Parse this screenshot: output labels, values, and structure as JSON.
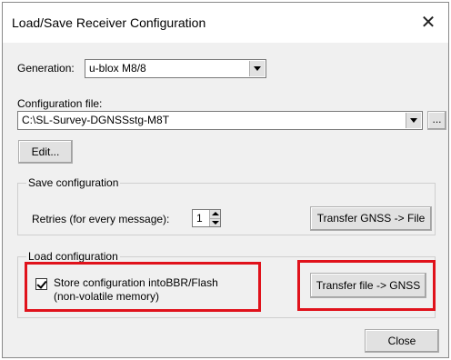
{
  "window": {
    "title": "Load/Save Receiver Configuration",
    "close_glyph": "✕"
  },
  "generation": {
    "label": "Generation:",
    "value": "u-blox M8/8"
  },
  "config_file": {
    "label": "Configuration file:",
    "value": "C:\\SL-Survey-DGNSSstg-M8T",
    "browse_label": "...",
    "edit_label": "Edit..."
  },
  "save": {
    "group_label": "Save configuration",
    "retries_label": "Retries (for every message):",
    "retries_value": "1",
    "transfer_label": "Transfer GNSS -> File"
  },
  "load": {
    "group_label": "Load configuration",
    "store_line1": "Store configuration intoBBR/Flash",
    "store_line2": "(non-volatile memory)",
    "store_checked": true,
    "transfer_label": "Transfer file -> GNSS"
  },
  "footer": {
    "close_label": "Close"
  },
  "colors": {
    "highlight": "#e0121b",
    "dialog_bg": "#f0f0f0"
  }
}
